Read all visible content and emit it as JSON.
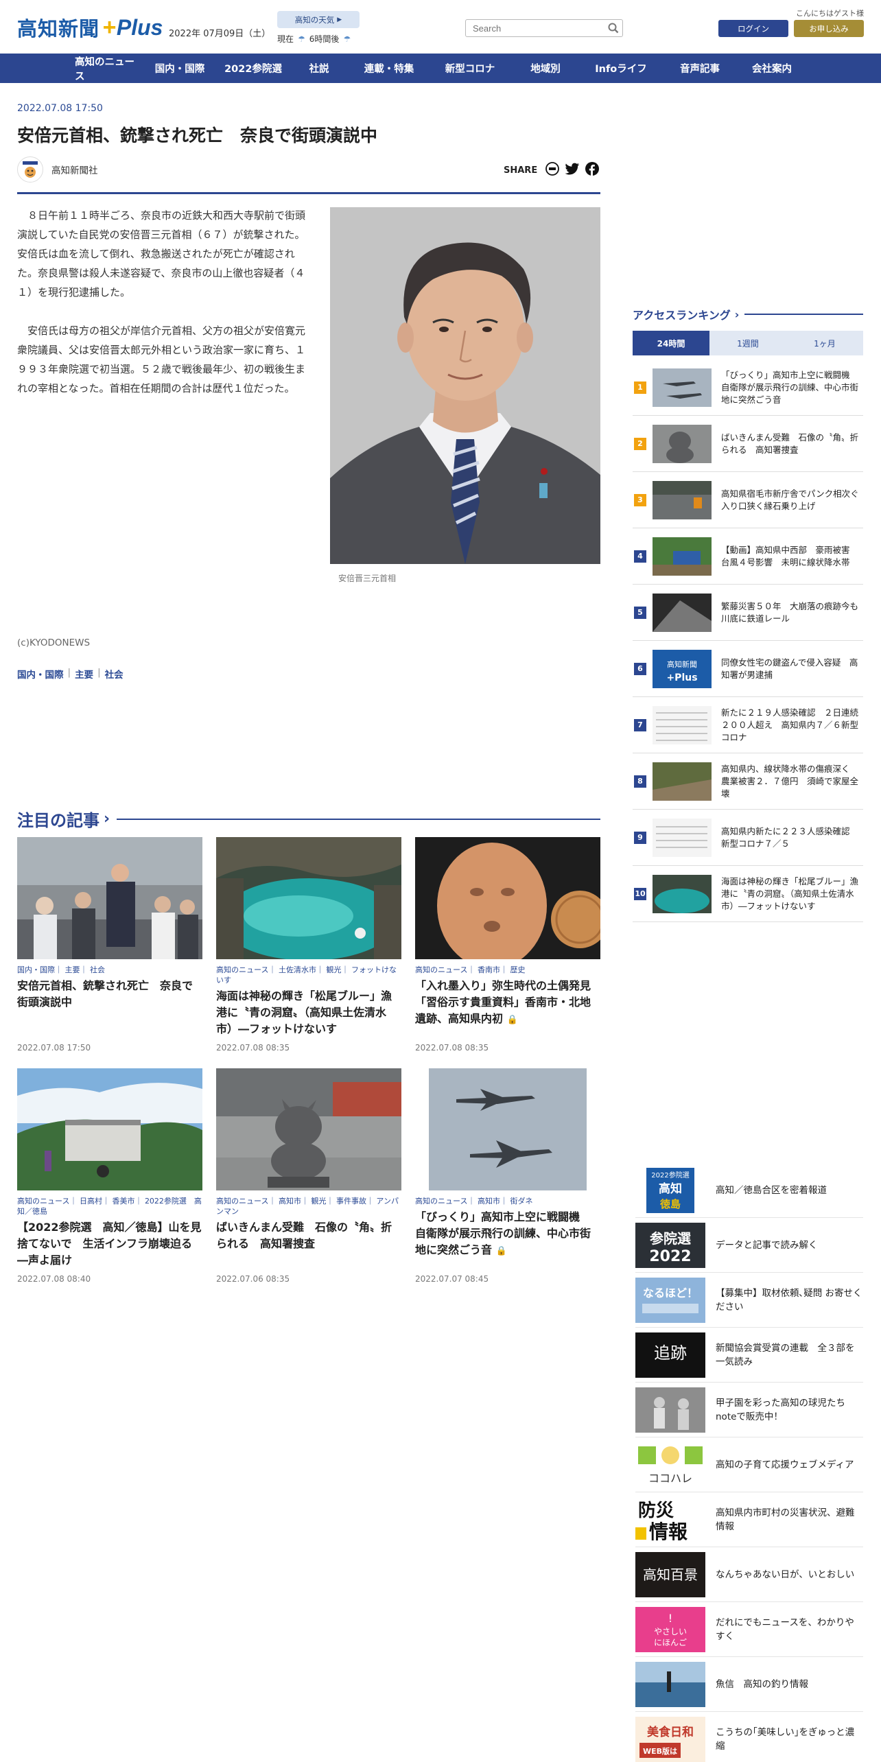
{
  "header": {
    "logo_text": "高知新聞",
    "logo_plus": "Plus",
    "date": "2022年 07月09日（土）",
    "weather_button": "高知の天気",
    "weather_now_label": "現在",
    "weather_6h_label": "6時間後",
    "search_placeholder": "Search",
    "greeting": "こんにちはゲスト様",
    "login_label": "ログイン",
    "subscribe_label": "お申し込み"
  },
  "nav": {
    "items": [
      "高知のニュース",
      "国内・国際",
      "2022参院選",
      "社説",
      "連載・特集",
      "新型コロナ",
      "地域別",
      "Infoライフ",
      "音声記事",
      "会社案内"
    ]
  },
  "article": {
    "date": "2022.07.08 17:50",
    "title": "安倍元首相、銃撃され死亡　奈良で街頭演説中",
    "publisher": "高知新聞社",
    "share_label": "SHARE",
    "paragraphs": [
      "　８日午前１１時半ごろ、奈良市の近鉄大和西大寺駅前で街頭演説していた自民党の安倍晋三元首相（６７）が銃撃された。安倍氏は血を流して倒れ、救急搬送されたが死亡が確認された。奈良県警は殺人未遂容疑で、奈良市の山上徹也容疑者（４１）を現行犯逮捕した。",
      "　安倍氏は母方の祖父が岸信介元首相、父方の祖父が安倍寛元衆院議員、父は安倍晋太郎元外相という政治家一家に育ち、１９９３年衆院選で初当選。５２歳で戦後最年少、初の戦後生まれの宰相となった。首相在任期間の合計は歴代１位だった。"
    ],
    "photo_caption": "安倍晋三元首相",
    "credit": "(c)KYODONEWS",
    "tags": [
      "国内・国際",
      "主要",
      "社会"
    ]
  },
  "featured": {
    "heading": "注目の記事",
    "cards": [
      {
        "cats": "国内・国際｜ 主要｜ 社会",
        "title": "安倍元首相、銃撃され死亡　奈良で街頭演説中",
        "date": "2022.07.08 17:50",
        "locked": false
      },
      {
        "cats": "高知のニュース｜ 土佐清水市｜ 観光｜ フォットけないす",
        "title": "海面は神秘の輝き「松尾ブルー」漁港に〝青の洞窟〟（高知県土佐清水市）―フォットけないす",
        "date": "2022.07.08 08:35",
        "locked": false
      },
      {
        "cats": "高知のニュース｜ 香南市｜ 歴史",
        "title": "「入れ墨入り」弥生時代の土偶発見「習俗示す貴重資料」香南市・北地遺跡、高知県内初",
        "date": "2022.07.08 08:35",
        "locked": true
      },
      {
        "cats": "高知のニュース｜ 日高村｜ 香美市｜ 2022参院選　高知／徳島",
        "title": "【2022参院選　高知／徳島】山を見捨てないで　生活インフラ崩壊迫る―声よ届け",
        "date": "2022.07.08 08:40",
        "locked": false
      },
      {
        "cats": "高知のニュース｜ 高知市｜ 観光｜ 事件事故｜ アンパンマン",
        "title": "ばいきんまん受難　石像の〝角〟折られる　高知署捜査",
        "date": "2022.07.06 08:35",
        "locked": false
      },
      {
        "cats": "高知のニュース｜ 高知市｜ 街ダネ",
        "title": "「びっくり」高知市上空に戦闘機　自衛隊が展示飛行の訓練、中心市街地に突然ごう音",
        "date": "2022.07.07 08:45",
        "locked": true
      }
    ]
  },
  "ranking": {
    "heading": "アクセスランキング",
    "tabs": [
      "24時間",
      "1週間",
      "1ヶ月"
    ],
    "active_tab": 0,
    "items": [
      {
        "num": "1",
        "text": "「びっくり」高知市上空に戦闘機　自衛隊が展示飛行の訓練、中心市街地に突然ごう音"
      },
      {
        "num": "2",
        "text": "ばいきんまん受難　石像の〝角〟折られる　高知署捜査"
      },
      {
        "num": "3",
        "text": "高知県宿毛市新庁舎でパンク相次ぐ　入り口狭く縁石乗り上げ"
      },
      {
        "num": "4",
        "text": "【動画】高知県中西部　豪雨被害　台風４号影響　未明に線状降水帯"
      },
      {
        "num": "5",
        "text": "繁藤災害５０年　大崩落の痕跡今も　川底に鉄道レール"
      },
      {
        "num": "6",
        "text": "同僚女性宅の鍵盗んで侵入容疑　高知署が男逮捕"
      },
      {
        "num": "7",
        "text": "新たに２１９人感染確認　２日連続２００人超え　高知県内７／６新型コロナ"
      },
      {
        "num": "8",
        "text": "高知県内、線状降水帯の傷痕深く　農業被害２．７億円　須崎で家屋全壊"
      },
      {
        "num": "9",
        "text": "高知県内新たに２２３人感染確認　新型コロナ７／５"
      },
      {
        "num": "10",
        "text": "海面は神秘の輝き「松尾ブルー」漁港に〝青の洞窟〟（高知県土佐清水市）―フォットけないす"
      }
    ]
  },
  "banners": [
    {
      "img_text": "2022参院選 高知徳島",
      "text": "高知／徳島合区を密着報道"
    },
    {
      "img_text": "参院選2022",
      "text": "データと記事で読み解く"
    },
    {
      "img_text": "なるほど！",
      "text": "【募集中】取材依頼､疑問 お寄せください"
    },
    {
      "img_text": "追跡",
      "text": "新聞協会賞受賞の連載　全３部を一気読み"
    },
    {
      "img_text": "",
      "text": "甲子園を彩った高知の球児たち noteで販売中！"
    },
    {
      "img_text": "ココハレ",
      "text": "高知の子育て応援ウェブメディア"
    },
    {
      "img_text": "防災情報",
      "text": "高知県内市町村の災害状況、避難情報"
    },
    {
      "img_text": "高知百景",
      "text": "なんちゃあない日が、いとおしい"
    },
    {
      "img_text": "やさしいにほんご",
      "text": "だれにでもニュースを、わかりやすく"
    },
    {
      "img_text": "",
      "text": "魚信　高知の釣り情報"
    },
    {
      "img_text": "美食日和",
      "text": "こうちの｢美味しい｣をぎゅっと濃縮"
    }
  ]
}
